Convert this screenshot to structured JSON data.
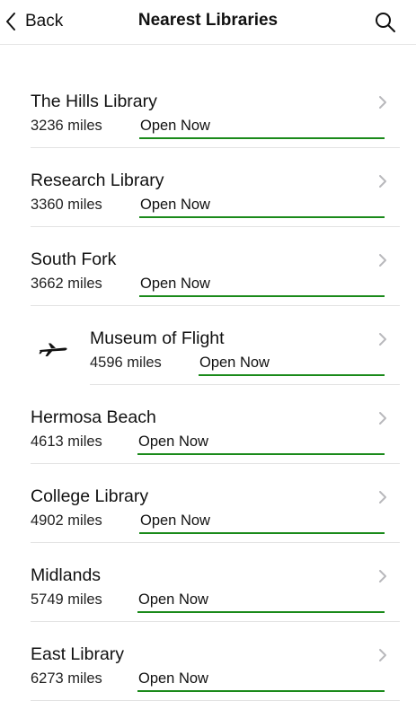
{
  "header": {
    "back_label": "Back",
    "title": "Nearest Libraries",
    "back_icon": "chevron-left-icon",
    "search_icon": "search-icon"
  },
  "colors": {
    "status_underline": "#1a8a1a",
    "divider": "#e3e3e3"
  },
  "libraries": [
    {
      "name": "The Hills Library",
      "distance": "3236 miles",
      "status": "Open Now"
    },
    {
      "name": "Research Library",
      "distance": "3360 miles",
      "status": "Open Now"
    },
    {
      "name": "South Fork",
      "distance": "3662 miles",
      "status": "Open Now"
    },
    {
      "name": "Museum of Flight",
      "distance": "4596 miles",
      "status": "Open Now",
      "icon": "airplane-icon"
    },
    {
      "name": "Hermosa Beach",
      "distance": "4613 miles",
      "status": "Open Now"
    },
    {
      "name": "College Library",
      "distance": "4902 miles",
      "status": "Open Now"
    },
    {
      "name": "Midlands",
      "distance": "5749 miles",
      "status": "Open Now"
    },
    {
      "name": "East Library",
      "distance": "6273 miles",
      "status": "Open Now"
    }
  ]
}
